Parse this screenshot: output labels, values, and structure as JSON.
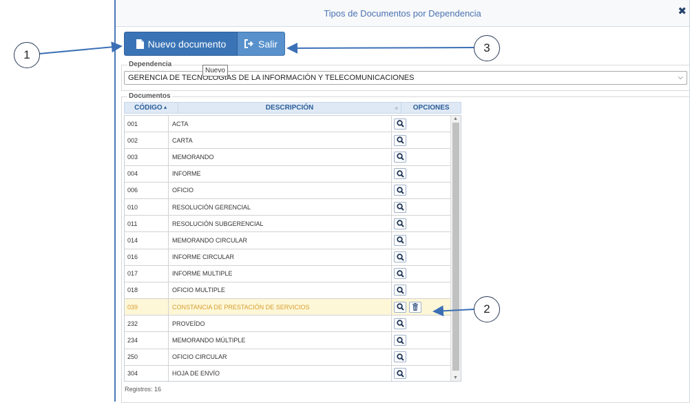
{
  "window": {
    "title": "Tipos de Documentos por Dependencia",
    "close_label": "✖"
  },
  "toolbar": {
    "new_label": "Nuevo documento",
    "exit_label": "Salir",
    "tooltip": "Nuevo"
  },
  "dependencia": {
    "legend": "Dependencia",
    "value": "GERENCIA DE TECNOLOGÍAS DE LA INFORMACIÓN Y TELECOMUNICACIONES"
  },
  "documentos": {
    "legend": "Documentos",
    "columns": [
      "CÓDIGO",
      "DESCRIPCIÓN",
      "OPCIONES"
    ],
    "rows": [
      {
        "code": "001",
        "desc": "ACTA"
      },
      {
        "code": "002",
        "desc": "CARTA"
      },
      {
        "code": "003",
        "desc": "MEMORANDO"
      },
      {
        "code": "004",
        "desc": "INFORME"
      },
      {
        "code": "006",
        "desc": "OFICIO"
      },
      {
        "code": "010",
        "desc": "RESOLUCIÓN GERENCIAL"
      },
      {
        "code": "011",
        "desc": "RESOLUCIÓN SUBGERENCIAL"
      },
      {
        "code": "014",
        "desc": "MEMORANDO CIRCULAR"
      },
      {
        "code": "016",
        "desc": "INFORME CIRCULAR"
      },
      {
        "code": "017",
        "desc": "INFORME MULTIPLE"
      },
      {
        "code": "018",
        "desc": "OFICIO MULTIPLE"
      },
      {
        "code": "039",
        "desc": "CONSTANCIA DE PRESTACIÓN DE SERVICIOS",
        "selected": true
      },
      {
        "code": "232",
        "desc": "PROVEÍDO"
      },
      {
        "code": "234",
        "desc": "MEMORANDO MÚLTIPLE"
      },
      {
        "code": "250",
        "desc": "OFICIO CIRCULAR"
      },
      {
        "code": "304",
        "desc": "HOJA DE ENVÍO"
      }
    ],
    "footer": "Registros: 16"
  },
  "callouts": [
    "1",
    "2",
    "3"
  ],
  "colors": {
    "accent": "#3b74b6",
    "selected_row": "#fdf7d7",
    "selected_text": "#d79c2f"
  },
  "icons": {
    "new": "file-icon",
    "exit": "sign-out-icon",
    "view": "search-icon",
    "delete": "trash-icon"
  }
}
